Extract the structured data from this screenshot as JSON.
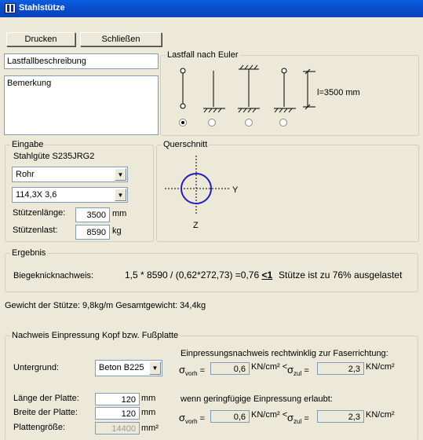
{
  "window": {
    "title": "Stahlstütze"
  },
  "toolbar": {
    "print_label": "Drucken",
    "close_label": "Schließen"
  },
  "description": {
    "load_case": "Lastfallbeschreibung",
    "remark": "Bemerkung"
  },
  "euler": {
    "label": "Lastfall nach Euler",
    "length_label": "l=3500 mm",
    "options": [
      "1",
      "2",
      "3",
      "4"
    ],
    "selected_index": 0
  },
  "input": {
    "label": "Eingabe",
    "steel_grade": "Stahlgüte S235JRG2",
    "profile_type": "Rohr",
    "profile_size": "114,3X 3,6",
    "length_label": "Stützenlänge:",
    "length_value": "3500",
    "length_unit": "mm",
    "load_label": "Stützenlast:",
    "load_value": "8590",
    "load_unit": "kg"
  },
  "cross_section": {
    "label": "Querschnitt",
    "axis_y": "Y",
    "axis_z": "Z"
  },
  "result": {
    "label": "Ergebnis",
    "check_label": "Biegeknicknachweis:",
    "formula": "1,5 * 8590 / (0,62*272,73) =0,76",
    "comparator": "<1",
    "utilization": "Stütze ist zu 76% ausgelastet"
  },
  "weight": {
    "text": "Gewicht der Stütze: 9,8kg/m  Gesamtgewicht: 34,4kg"
  },
  "plate": {
    "label": "Nachweis Einpressung Kopf bzw. Fußplatte",
    "ground_label": "Untergrund:",
    "ground_value": "Beton B225",
    "length_label": "Länge der Platte:",
    "length_value": "120",
    "length_unit": "mm",
    "width_label": "Breite der Platte:",
    "width_value": "120",
    "width_unit": "mm",
    "size_label": "Plattengröße:",
    "size_value": "14400",
    "size_unit": "mm²",
    "perp_title": "Einpressungsnachweis rechtwinklig zur Faserrichtung:",
    "allowed_title": "wenn geringfügige Einpressung erlaubt:",
    "sigma_vorh_label": "vorh",
    "sigma_zul_label": "zul",
    "perp_vorh": "0,6",
    "perp_zul": "2,3",
    "allowed_vorh": "0,6",
    "allowed_zul": "2,3",
    "unit_lt": "KN/cm² <",
    "unit": "KN/cm²"
  },
  "colors": {
    "titlebar": "#0a4fd0",
    "panel": "#ece9d8",
    "circle": "#1f1fbf"
  }
}
